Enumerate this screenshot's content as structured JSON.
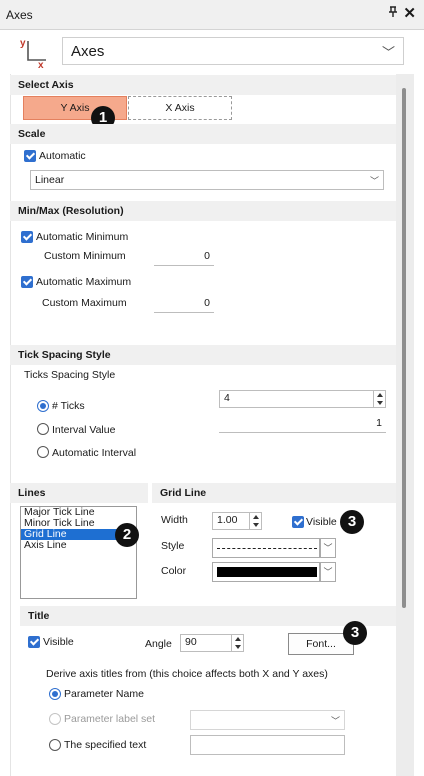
{
  "window": {
    "title": "Axes",
    "pin_glyph": "∙",
    "close_glyph": "✕"
  },
  "header": {
    "logo_icon": "axes-logo-icon",
    "logo_y": "y",
    "logo_x": "x",
    "select_value": "Axes"
  },
  "select_axis": {
    "heading": "Select Axis",
    "y_label": "Y Axis",
    "x_label": "X Axis",
    "selected": "Y Axis",
    "badge": "1"
  },
  "scale": {
    "heading": "Scale",
    "automatic_label": "Automatic",
    "automatic_checked": true,
    "type_value": "Linear"
  },
  "minmax": {
    "heading": "Min/Max (Resolution)",
    "auto_min_label": "Automatic Minimum",
    "auto_min_checked": true,
    "custom_min_label": "Custom Minimum",
    "custom_min_value": "0",
    "auto_max_label": "Automatic Maximum",
    "auto_max_checked": true,
    "custom_max_label": "Custom Maximum",
    "custom_max_value": "0"
  },
  "tick_spacing": {
    "heading": "Tick Spacing Style",
    "sub_label": "Ticks Spacing Style",
    "options": [
      "# Ticks",
      "Interval Value",
      "Automatic Interval"
    ],
    "selected": "# Ticks",
    "ticks_value": "4",
    "interval_value": "1"
  },
  "lines": {
    "heading": "Lines",
    "items": [
      "Major Tick Line",
      "Minor Tick Line",
      "Grid Line",
      "Axis Line"
    ],
    "selected": "Grid Line",
    "badge": "2"
  },
  "grid_line": {
    "heading": "Grid Line",
    "width_label": "Width",
    "width_value": "1.00",
    "visible_label": "Visible",
    "visible_checked": true,
    "style_label": "Style",
    "color_label": "Color",
    "color_value": "#000000",
    "badge": "3"
  },
  "title": {
    "heading": "Title",
    "visible_label": "Visible",
    "visible_checked": true,
    "angle_label": "Angle",
    "angle_value": "90",
    "font_button": "Font...",
    "badge": "3",
    "derive_label": "Derive axis titles from (this choice affects both X and Y axes)",
    "derive_options": [
      "Parameter Name",
      "Parameter label set",
      "The specified text"
    ],
    "derive_selected": "Parameter Name",
    "specified_text_value": ""
  },
  "colors": {
    "accent": "#2f6fcf",
    "selected_tab": "#f5a98c",
    "list_selection": "#1e6fd2",
    "section_bg": "#f0f0f0"
  }
}
